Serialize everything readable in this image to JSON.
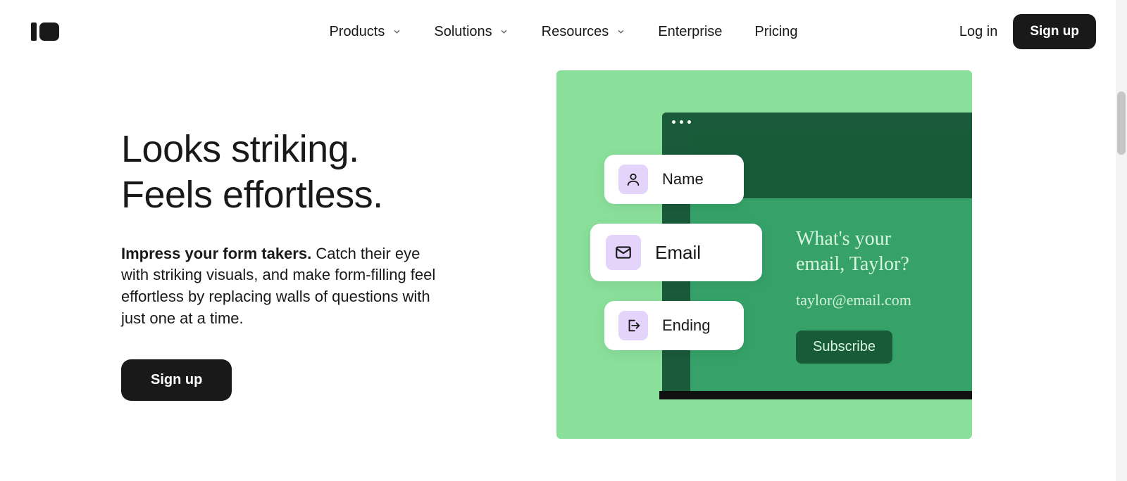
{
  "nav": {
    "items": [
      {
        "label": "Products",
        "has_dropdown": true
      },
      {
        "label": "Solutions",
        "has_dropdown": true
      },
      {
        "label": "Resources",
        "has_dropdown": true
      },
      {
        "label": "Enterprise",
        "has_dropdown": false
      },
      {
        "label": "Pricing",
        "has_dropdown": false
      }
    ],
    "login": "Log in",
    "signup": "Sign up"
  },
  "hero": {
    "title_line1": "Looks striking.",
    "title_line2": "Feels effortless.",
    "desc_bold": "Impress your form takers.",
    "desc_rest": " Catch their eye with striking visuals, and make form-filling feel effortless by replacing walls of questions with just one at a time.",
    "cta": "Sign up"
  },
  "illustration": {
    "chips": [
      {
        "label": "Name",
        "icon": "user-icon"
      },
      {
        "label": "Email",
        "icon": "mail-icon"
      },
      {
        "label": "Ending",
        "icon": "exit-icon"
      }
    ],
    "question_line1": "What's your",
    "question_line2": "email, Taylor?",
    "email_value": "taylor@email.com",
    "subscribe": "Subscribe"
  }
}
